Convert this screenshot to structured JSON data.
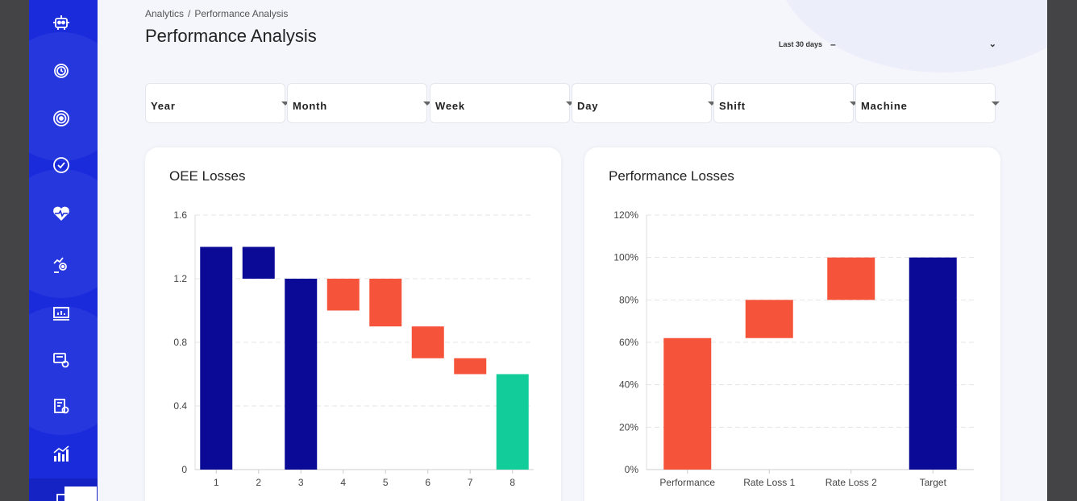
{
  "breadcrumb": {
    "parent": "Analytics",
    "separator": "/",
    "current": "Performance Analysis"
  },
  "page_title": "Performance Analysis",
  "date_range": {
    "selected": "Last 30 days"
  },
  "filters": [
    "Year",
    "Month",
    "Week",
    "Day",
    "Shift",
    "Machine"
  ],
  "sidebar": {
    "items": [
      "robot-icon",
      "clock-gear-icon",
      "target-icon",
      "check-badge-icon",
      "heartbeat-icon",
      "hand-gear-icon",
      "monitor-chart-icon",
      "factory-settings-icon",
      "document-gear-icon",
      "bar-chart-icon",
      "dashboard-icon"
    ]
  },
  "colors": {
    "sidebar": "#1a2bdc",
    "navy": "#0a0a96",
    "loss": "#f5533a",
    "result": "#12cc99"
  },
  "charts": {
    "oee": {
      "title": "OEE Losses"
    },
    "performance": {
      "title": "Performance Losses"
    }
  },
  "chart_data": [
    {
      "type": "bar",
      "subtype": "waterfall",
      "title": "OEE Losses",
      "categories": [
        "1",
        "2",
        "3",
        "4",
        "5",
        "6",
        "7",
        "8"
      ],
      "series": [
        {
          "bars": [
            {
              "low": 0,
              "high": 1.4,
              "color": "#0a0a96"
            },
            {
              "low": 1.2,
              "high": 1.4,
              "color": "#0a0a96"
            },
            {
              "low": 0,
              "high": 1.2,
              "color": "#0a0a96"
            },
            {
              "low": 1.0,
              "high": 1.2,
              "color": "#f5533a"
            },
            {
              "low": 0.9,
              "high": 1.2,
              "color": "#f5533a"
            },
            {
              "low": 0.7,
              "high": 0.9,
              "color": "#f5533a"
            },
            {
              "low": 0.6,
              "high": 0.7,
              "color": "#f5533a"
            },
            {
              "low": 0,
              "high": 0.6,
              "color": "#12cc99"
            }
          ]
        }
      ],
      "ylim": [
        0,
        1.6
      ],
      "yticks": [
        "0",
        "0.4",
        "0.8",
        "1.2",
        "1.6"
      ],
      "grid": true
    },
    {
      "type": "bar",
      "subtype": "waterfall",
      "title": "Performance Losses",
      "categories": [
        "Performance",
        "Rate Loss 1",
        "Rate Loss 2",
        "Target"
      ],
      "series": [
        {
          "bars": [
            {
              "low": 0,
              "high": 62,
              "color": "#f5533a"
            },
            {
              "low": 62,
              "high": 80,
              "color": "#f5533a"
            },
            {
              "low": 80,
              "high": 100,
              "color": "#f5533a"
            },
            {
              "low": 0,
              "high": 100,
              "color": "#0a0a96"
            }
          ]
        }
      ],
      "ylim": [
        0,
        120
      ],
      "yticks": [
        "0%",
        "20%",
        "40%",
        "60%",
        "80%",
        "100%",
        "120%"
      ],
      "grid": true
    }
  ]
}
